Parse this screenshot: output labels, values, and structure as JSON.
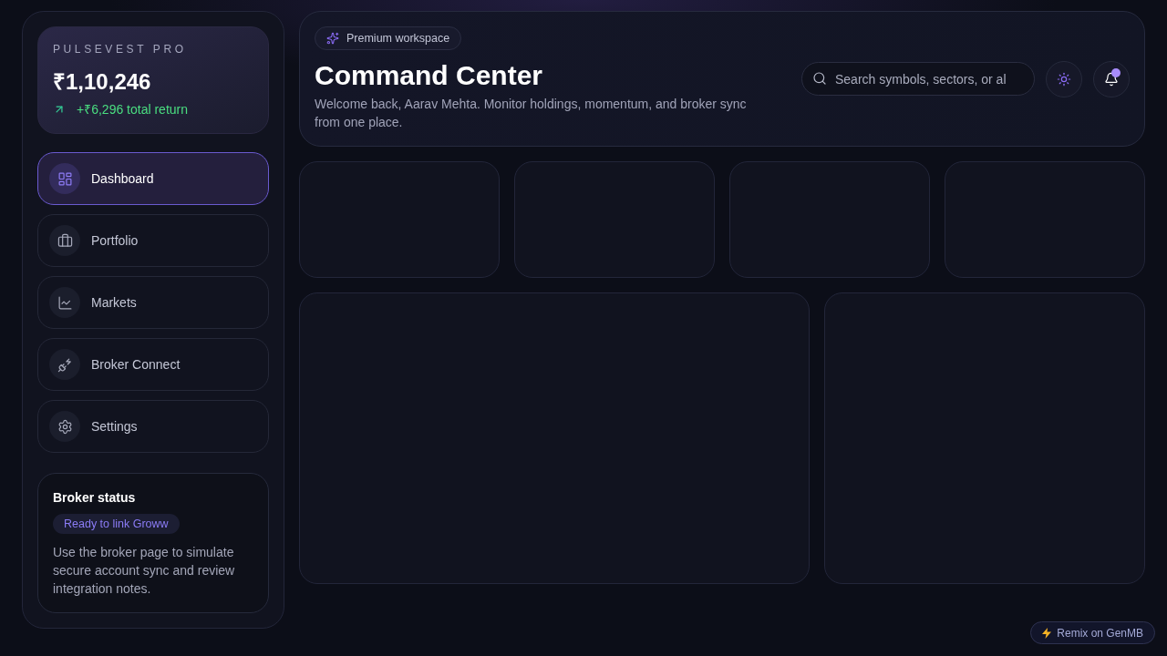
{
  "sidebar": {
    "brand": {
      "label": "PULSEVEST PRO",
      "balance": "₹1,10,246",
      "return": "+₹6,296 total return"
    },
    "nav": [
      {
        "label": "Dashboard",
        "selected": true
      },
      {
        "label": "Portfolio",
        "selected": false
      },
      {
        "label": "Markets",
        "selected": false
      },
      {
        "label": "Broker Connect",
        "selected": false
      },
      {
        "label": "Settings",
        "selected": false
      }
    ],
    "broker_status": {
      "title": "Broker status",
      "badge": "Ready to link Groww",
      "text": "Use the broker page to simulate secure account sync and review integration notes."
    }
  },
  "header": {
    "badge": "Premium workspace",
    "title": "Command Center",
    "subtitle": "Welcome back, Aarav Mehta. Monitor holdings, momentum, and broker sync from one place.",
    "search": {
      "placeholder": "Search symbols, sectors, or al"
    },
    "notifications": {
      "unread": true
    }
  },
  "stat_cards": [
    {
      "kind": "blank"
    },
    {
      "kind": "blank"
    },
    {
      "kind": "blank"
    },
    {
      "kind": "blank"
    }
  ],
  "panels": [
    {
      "kind": "blank"
    },
    {
      "kind": "blank"
    }
  ],
  "remix_badge": {
    "label": "Remix on GenMB"
  }
}
